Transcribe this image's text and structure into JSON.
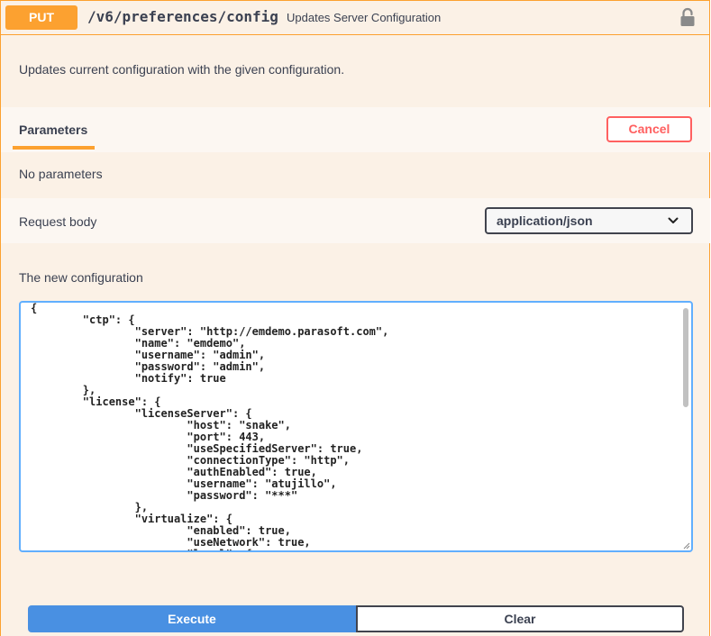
{
  "operation": {
    "method": "PUT",
    "path": "/v6/preferences/config",
    "summary": "Updates Server Configuration",
    "description": "Updates current configuration with the given configuration.",
    "lock_icon": "lock-icon"
  },
  "parameters": {
    "title": "Parameters",
    "cancel_label": "Cancel",
    "empty_text": "No parameters"
  },
  "request_body": {
    "label": "Request body",
    "content_type": "application/json",
    "description": "The new configuration",
    "value": "{\n\t\"ctp\": {\n\t\t\"server\": \"http://emdemo.parasoft.com\",\n\t\t\"name\": \"emdemo\",\n\t\t\"username\": \"admin\",\n\t\t\"password\": \"admin\",\n\t\t\"notify\": true\n\t},\n\t\"license\": {\n\t\t\"licenseServer\": {\n\t\t\t\"host\": \"snake\",\n\t\t\t\"port\": 443,\n\t\t\t\"useSpecifiedServer\": true,\n\t\t\t\"connectionType\": \"http\",\n\t\t\t\"authEnabled\": true,\n\t\t\t\"username\": \"atujillo\",\n\t\t\t\"password\": \"***\"\n\t\t},\n\t\t\"virtualize\": {\n\t\t\t\"enabled\": true,\n\t\t\t\"useNetwork\": true,\n\t\t\t\"local\": {"
  },
  "actions": {
    "execute_label": "Execute",
    "clear_label": "Clear"
  },
  "colors": {
    "put_accent": "#fca130",
    "block_background": "#fbf1e6",
    "cancel": "#ff6060",
    "execute": "#4990e2",
    "textarea_border": "#61affe"
  }
}
